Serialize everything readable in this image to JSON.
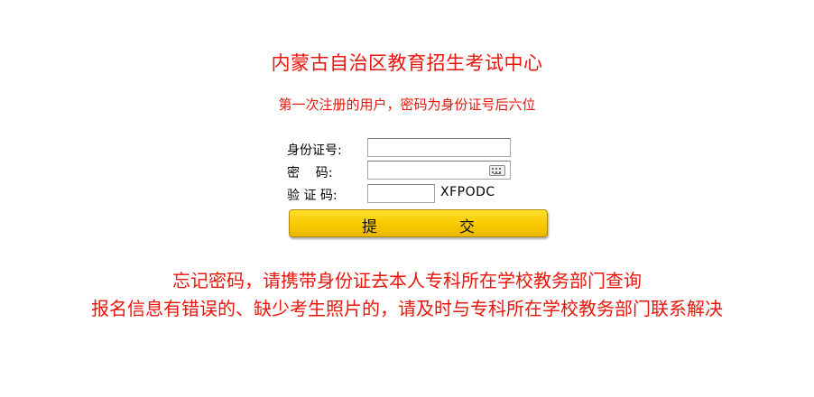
{
  "header": {
    "title": "内蒙古自治区教育招生考试中心",
    "subtitle": "第一次注册的用户，密码为身份证号后六位"
  },
  "form": {
    "id_label": "身份证号:",
    "id_value": "",
    "password_label": "密    码:",
    "password_value": "",
    "captcha_label": "验 证 码:",
    "captcha_value": "",
    "captcha_code": "XFPODC",
    "submit_left": "提",
    "submit_right": "交",
    "keyboard_icon": "keyboard-icon"
  },
  "notices": {
    "forgot_password": "忘记密码，请携带身份证去本人专科所在学校教务部门查询",
    "info_error": "报名信息有错误的、缺少考生照片的，请及时与专科所在学校教务部门联系解决"
  },
  "colors": {
    "accent_red": "#e8160c",
    "button_yellow": "#f7c900"
  }
}
